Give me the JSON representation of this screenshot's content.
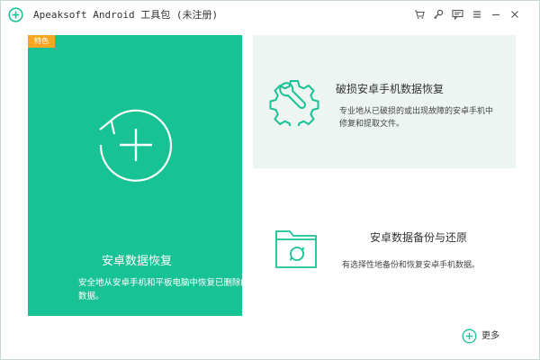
{
  "app": {
    "title": "Apeaksoft Android 工具包 (未注册)",
    "accent": "#17c295",
    "badge_color": "#f5a623"
  },
  "titlebar": {
    "icons": [
      "cart-icon",
      "key-icon",
      "feedback-icon",
      "menu-icon",
      "minimize-icon",
      "close-icon"
    ]
  },
  "cards": {
    "main": {
      "badge": "特色",
      "title": "安卓数据恢复",
      "description": "安全地从安卓手机和平板电脑中恢复已删除的数据。",
      "icon": "restore-plus-icon"
    },
    "broken": {
      "title": "破损安卓手机数据恢复",
      "description": "专业地从已破损的或出现故障的安卓手机中修复和提取文件。",
      "icon": "gear-wrench-icon"
    },
    "backup": {
      "title": "安卓数据备份与还原",
      "description": "有选择性地备份和恢复安卓手机数据。",
      "icon": "folder-sync-icon"
    }
  },
  "more": {
    "label": "更多",
    "icon": "plus-circle-icon"
  }
}
